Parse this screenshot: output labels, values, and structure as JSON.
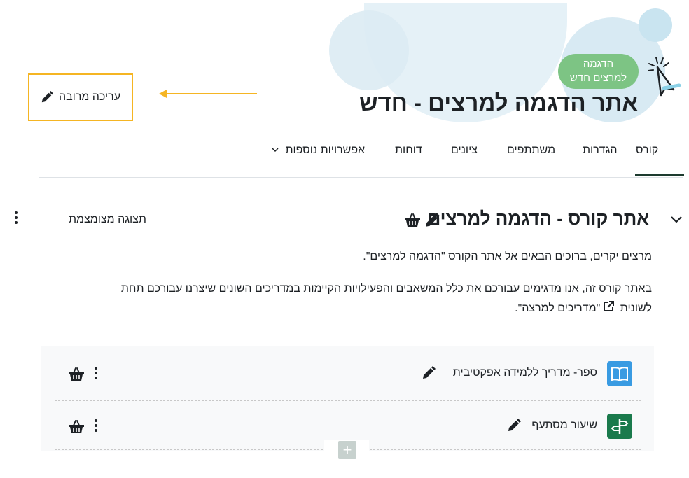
{
  "header": {
    "demo_badge_line1": "הדגמה",
    "demo_badge_line2": "למרצים חדש",
    "page_title": "אתר הדגמה למרצים - חדש",
    "bulk_edit_label": "עריכה מרובה",
    "highlight_color": "#f5b523",
    "accent_green": "#7dc484"
  },
  "tabs": [
    {
      "label": "קורס",
      "active": true
    },
    {
      "label": "הגדרות"
    },
    {
      "label": "משתתפים"
    },
    {
      "label": "ציונים"
    },
    {
      "label": "דוחות"
    },
    {
      "label": "אפשרויות נוספות"
    }
  ],
  "section": {
    "title": "אתר קורס - הדגמה למרצים",
    "collapsed_view_label": "תצוגה מצומצמת",
    "para1": "מרצים יקרים, ברוכים הבאים אל אתר הקורס \"הדגמה למרצים\".",
    "para2_line1": "באתר קורס זה, אנו מדגימים עבורכם את כלל המשאבים והפעילויות הקיימות במדריכים השונים שיצרנו עבורכם תחת",
    "para2_line2_before": "לשונית",
    "para2_line2_link": "\"מדריכים למרצה\"."
  },
  "activities": [
    {
      "name": "ספר- מדריך ללמידה אפקטיבית",
      "icon": "book-icon",
      "icon_color": "#399be2"
    },
    {
      "name": "שיעור מסתעף",
      "icon": "signpost-icon",
      "icon_color": "#1a7a4c"
    }
  ],
  "add_button_symbol": "+"
}
